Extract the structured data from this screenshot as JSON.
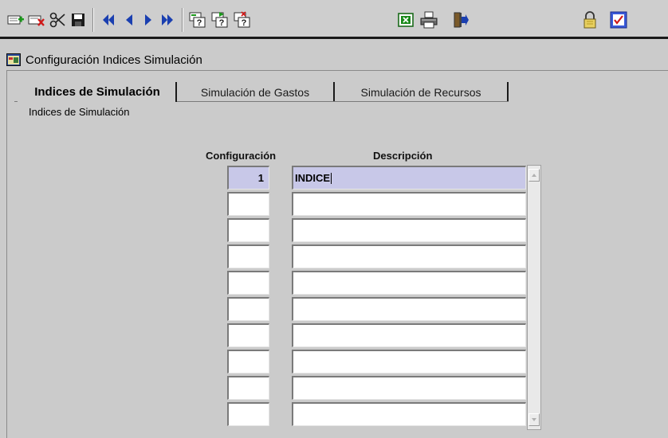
{
  "toolbar": {
    "buttons": [
      {
        "icon": "insert-record-icon"
      },
      {
        "icon": "delete-record-icon"
      },
      {
        "icon": "cut-icon"
      },
      {
        "icon": "save-icon"
      },
      {
        "icon": "first-record-icon"
      },
      {
        "icon": "previous-record-icon"
      },
      {
        "icon": "next-record-icon"
      },
      {
        "icon": "last-record-icon"
      },
      {
        "icon": "query-enter-icon"
      },
      {
        "icon": "query-execute-icon"
      },
      {
        "icon": "query-cancel-icon"
      },
      {
        "icon": "excel-icon"
      },
      {
        "icon": "print-icon"
      },
      {
        "icon": "exit-icon"
      },
      {
        "icon": "lock-icon"
      },
      {
        "icon": "check-icon"
      }
    ]
  },
  "window": {
    "title": "Configuración Indices Simulación",
    "icon": "form-window-icon"
  },
  "tabs": [
    {
      "label": "Indices de Simulación",
      "active": true
    },
    {
      "label": "Simulación de Gastos",
      "active": false
    },
    {
      "label": "Simulación de Recursos",
      "active": false
    }
  ],
  "section_label": "Indices de Simulación",
  "grid": {
    "headers": {
      "configuracion": "Configuración",
      "descripcion": "Descripción"
    },
    "rows": [
      {
        "configuracion": "1",
        "descripcion": "INDICE",
        "selected": true
      },
      {
        "configuracion": "",
        "descripcion": "",
        "selected": false
      },
      {
        "configuracion": "",
        "descripcion": "",
        "selected": false
      },
      {
        "configuracion": "",
        "descripcion": "",
        "selected": false
      },
      {
        "configuracion": "",
        "descripcion": "",
        "selected": false
      },
      {
        "configuracion": "",
        "descripcion": "",
        "selected": false
      },
      {
        "configuracion": "",
        "descripcion": "",
        "selected": false
      },
      {
        "configuracion": "",
        "descripcion": "",
        "selected": false
      },
      {
        "configuracion": "",
        "descripcion": "",
        "selected": false
      },
      {
        "configuracion": "",
        "descripcion": "",
        "selected": false
      }
    ]
  },
  "colors": {
    "selected_row": "#c8c8e8",
    "nav_arrow": "#1a3fb0",
    "window_bg": "#d0d0d0"
  }
}
